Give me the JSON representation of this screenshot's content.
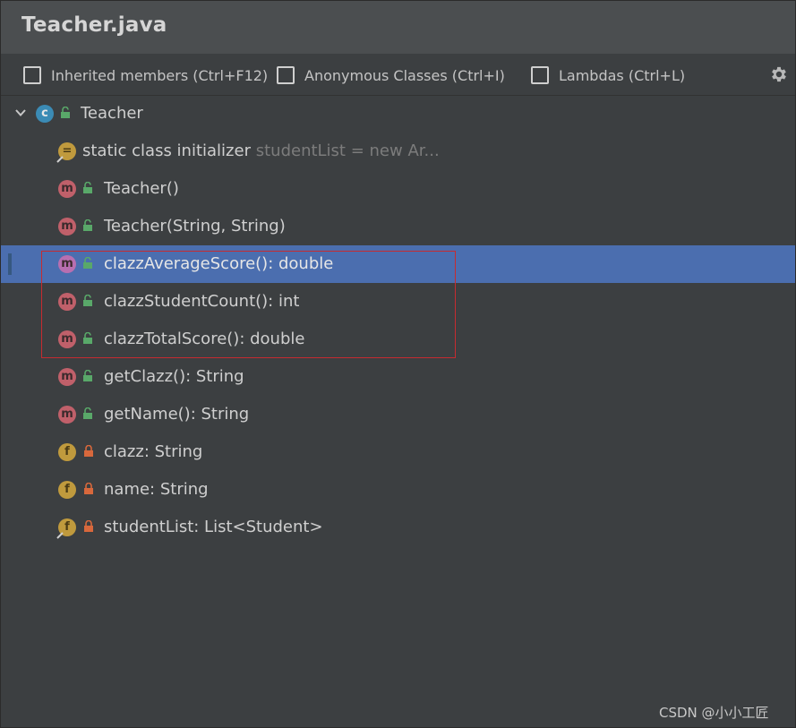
{
  "window": {
    "title": "Teacher.java"
  },
  "options": {
    "inherited": "Inherited members (Ctrl+F12)",
    "anonymous": "Anonymous Classes (Ctrl+I)",
    "lambdas": "Lambdas (Ctrl+L)"
  },
  "tree": {
    "root": {
      "badge": "c",
      "label": "Teacher"
    },
    "items": [
      {
        "badge": "=",
        "label": "static class initializer",
        "hint": "studentList = new Ar..."
      },
      {
        "badge": "m",
        "label": "Teacher()"
      },
      {
        "badge": "m",
        "label": "Teacher(String, String)"
      },
      {
        "badge": "m",
        "label": "clazzAverageScore(): double"
      },
      {
        "badge": "m",
        "label": "clazzStudentCount(): int"
      },
      {
        "badge": "m",
        "label": "clazzTotalScore(): double"
      },
      {
        "badge": "m",
        "label": "getClazz(): String"
      },
      {
        "badge": "m",
        "label": "getName(): String"
      },
      {
        "badge": "f",
        "label": "clazz: String"
      },
      {
        "badge": "f",
        "label": "name: String"
      },
      {
        "badge": "f",
        "label": "studentList: List<Student>"
      }
    ]
  },
  "colors": {
    "selection": "#4b6eaf",
    "highlight_box": "#c62b30",
    "public": "#59a869",
    "private": "#d8683c"
  },
  "watermark": "CSDN @小小工匠"
}
